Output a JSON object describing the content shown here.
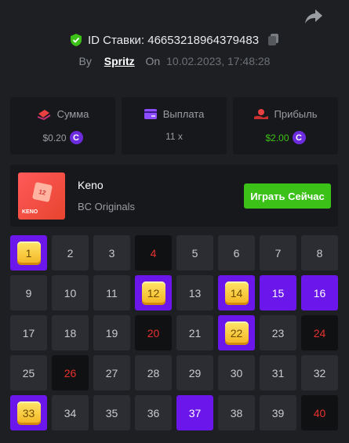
{
  "header": {
    "bet_id_label": "ID Ставки: 46653218964379483",
    "by_label": "By",
    "username": "Spritz",
    "on_label": "On",
    "date": "10.02.2023, 17:48:28"
  },
  "stats": [
    {
      "label": "Сумма",
      "value": "$0.20",
      "icon": "bet-amount-icon"
    },
    {
      "label": "Выплата",
      "value": "11 x",
      "icon": "payout-card-icon"
    },
    {
      "label": "Прибыль",
      "value": "$2.00",
      "icon": "profit-icon"
    }
  ],
  "game": {
    "thumb_text": "KENO",
    "thumb_number": "12",
    "name": "Keno",
    "provider": "BC Originals",
    "play_label": "Играть Сейчас"
  },
  "coin_symbol": "C",
  "colors": {
    "accent": "#6b16ea",
    "green": "#3bc117",
    "miss": "#e8312e"
  },
  "board": {
    "cells": [
      {
        "n": "1",
        "s": "hit"
      },
      {
        "n": "2",
        "s": "none"
      },
      {
        "n": "3",
        "s": "none"
      },
      {
        "n": "4",
        "s": "miss"
      },
      {
        "n": "5",
        "s": "none"
      },
      {
        "n": "6",
        "s": "none"
      },
      {
        "n": "7",
        "s": "none"
      },
      {
        "n": "8",
        "s": "none"
      },
      {
        "n": "9",
        "s": "none"
      },
      {
        "n": "10",
        "s": "none"
      },
      {
        "n": "11",
        "s": "none"
      },
      {
        "n": "12",
        "s": "hit"
      },
      {
        "n": "13",
        "s": "none"
      },
      {
        "n": "14",
        "s": "hit"
      },
      {
        "n": "15",
        "s": "pick"
      },
      {
        "n": "16",
        "s": "pick"
      },
      {
        "n": "17",
        "s": "none"
      },
      {
        "n": "18",
        "s": "none"
      },
      {
        "n": "19",
        "s": "none"
      },
      {
        "n": "20",
        "s": "miss"
      },
      {
        "n": "21",
        "s": "none"
      },
      {
        "n": "22",
        "s": "hit"
      },
      {
        "n": "23",
        "s": "none"
      },
      {
        "n": "24",
        "s": "miss"
      },
      {
        "n": "25",
        "s": "none"
      },
      {
        "n": "26",
        "s": "miss"
      },
      {
        "n": "27",
        "s": "none"
      },
      {
        "n": "28",
        "s": "none"
      },
      {
        "n": "29",
        "s": "none"
      },
      {
        "n": "30",
        "s": "none"
      },
      {
        "n": "31",
        "s": "none"
      },
      {
        "n": "32",
        "s": "none"
      },
      {
        "n": "33",
        "s": "hit"
      },
      {
        "n": "34",
        "s": "none"
      },
      {
        "n": "35",
        "s": "none"
      },
      {
        "n": "36",
        "s": "none"
      },
      {
        "n": "37",
        "s": "pick"
      },
      {
        "n": "38",
        "s": "none"
      },
      {
        "n": "39",
        "s": "none"
      },
      {
        "n": "40",
        "s": "miss"
      }
    ]
  }
}
